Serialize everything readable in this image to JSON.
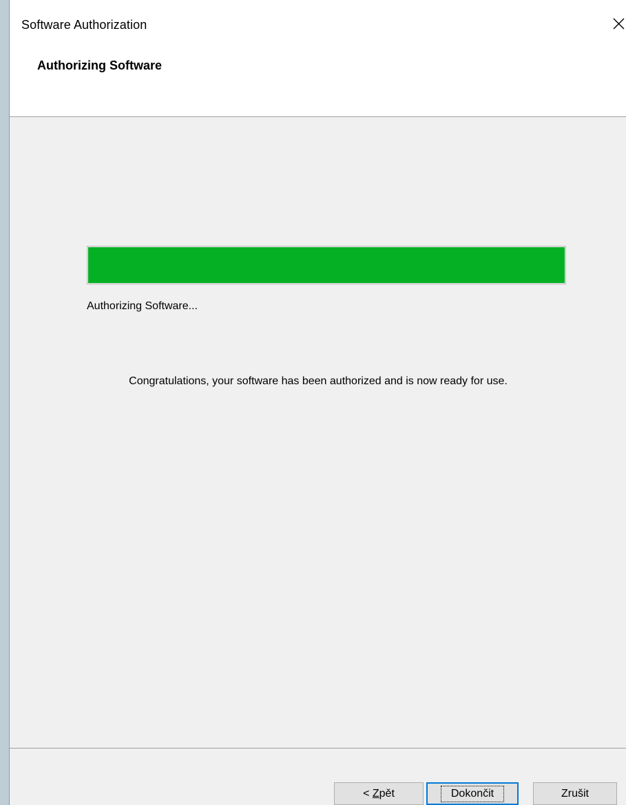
{
  "window": {
    "title": "Software Authorization",
    "close_icon": "close-icon"
  },
  "header": {
    "title": "Authorizing Software"
  },
  "progress": {
    "fraction": 1.0,
    "color": "#06b025",
    "status_text": "Authorizing Software..."
  },
  "message": "Congratulations, your software has been authorized and is now ready for use.",
  "buttons": {
    "back_prefix": "< ",
    "back_accel": "Z",
    "back_rest": "pět",
    "finish_label": "Dokončit",
    "cancel_label": "Zrušit"
  },
  "colors": {
    "accent": "#0078d7",
    "progress": "#06b025"
  }
}
